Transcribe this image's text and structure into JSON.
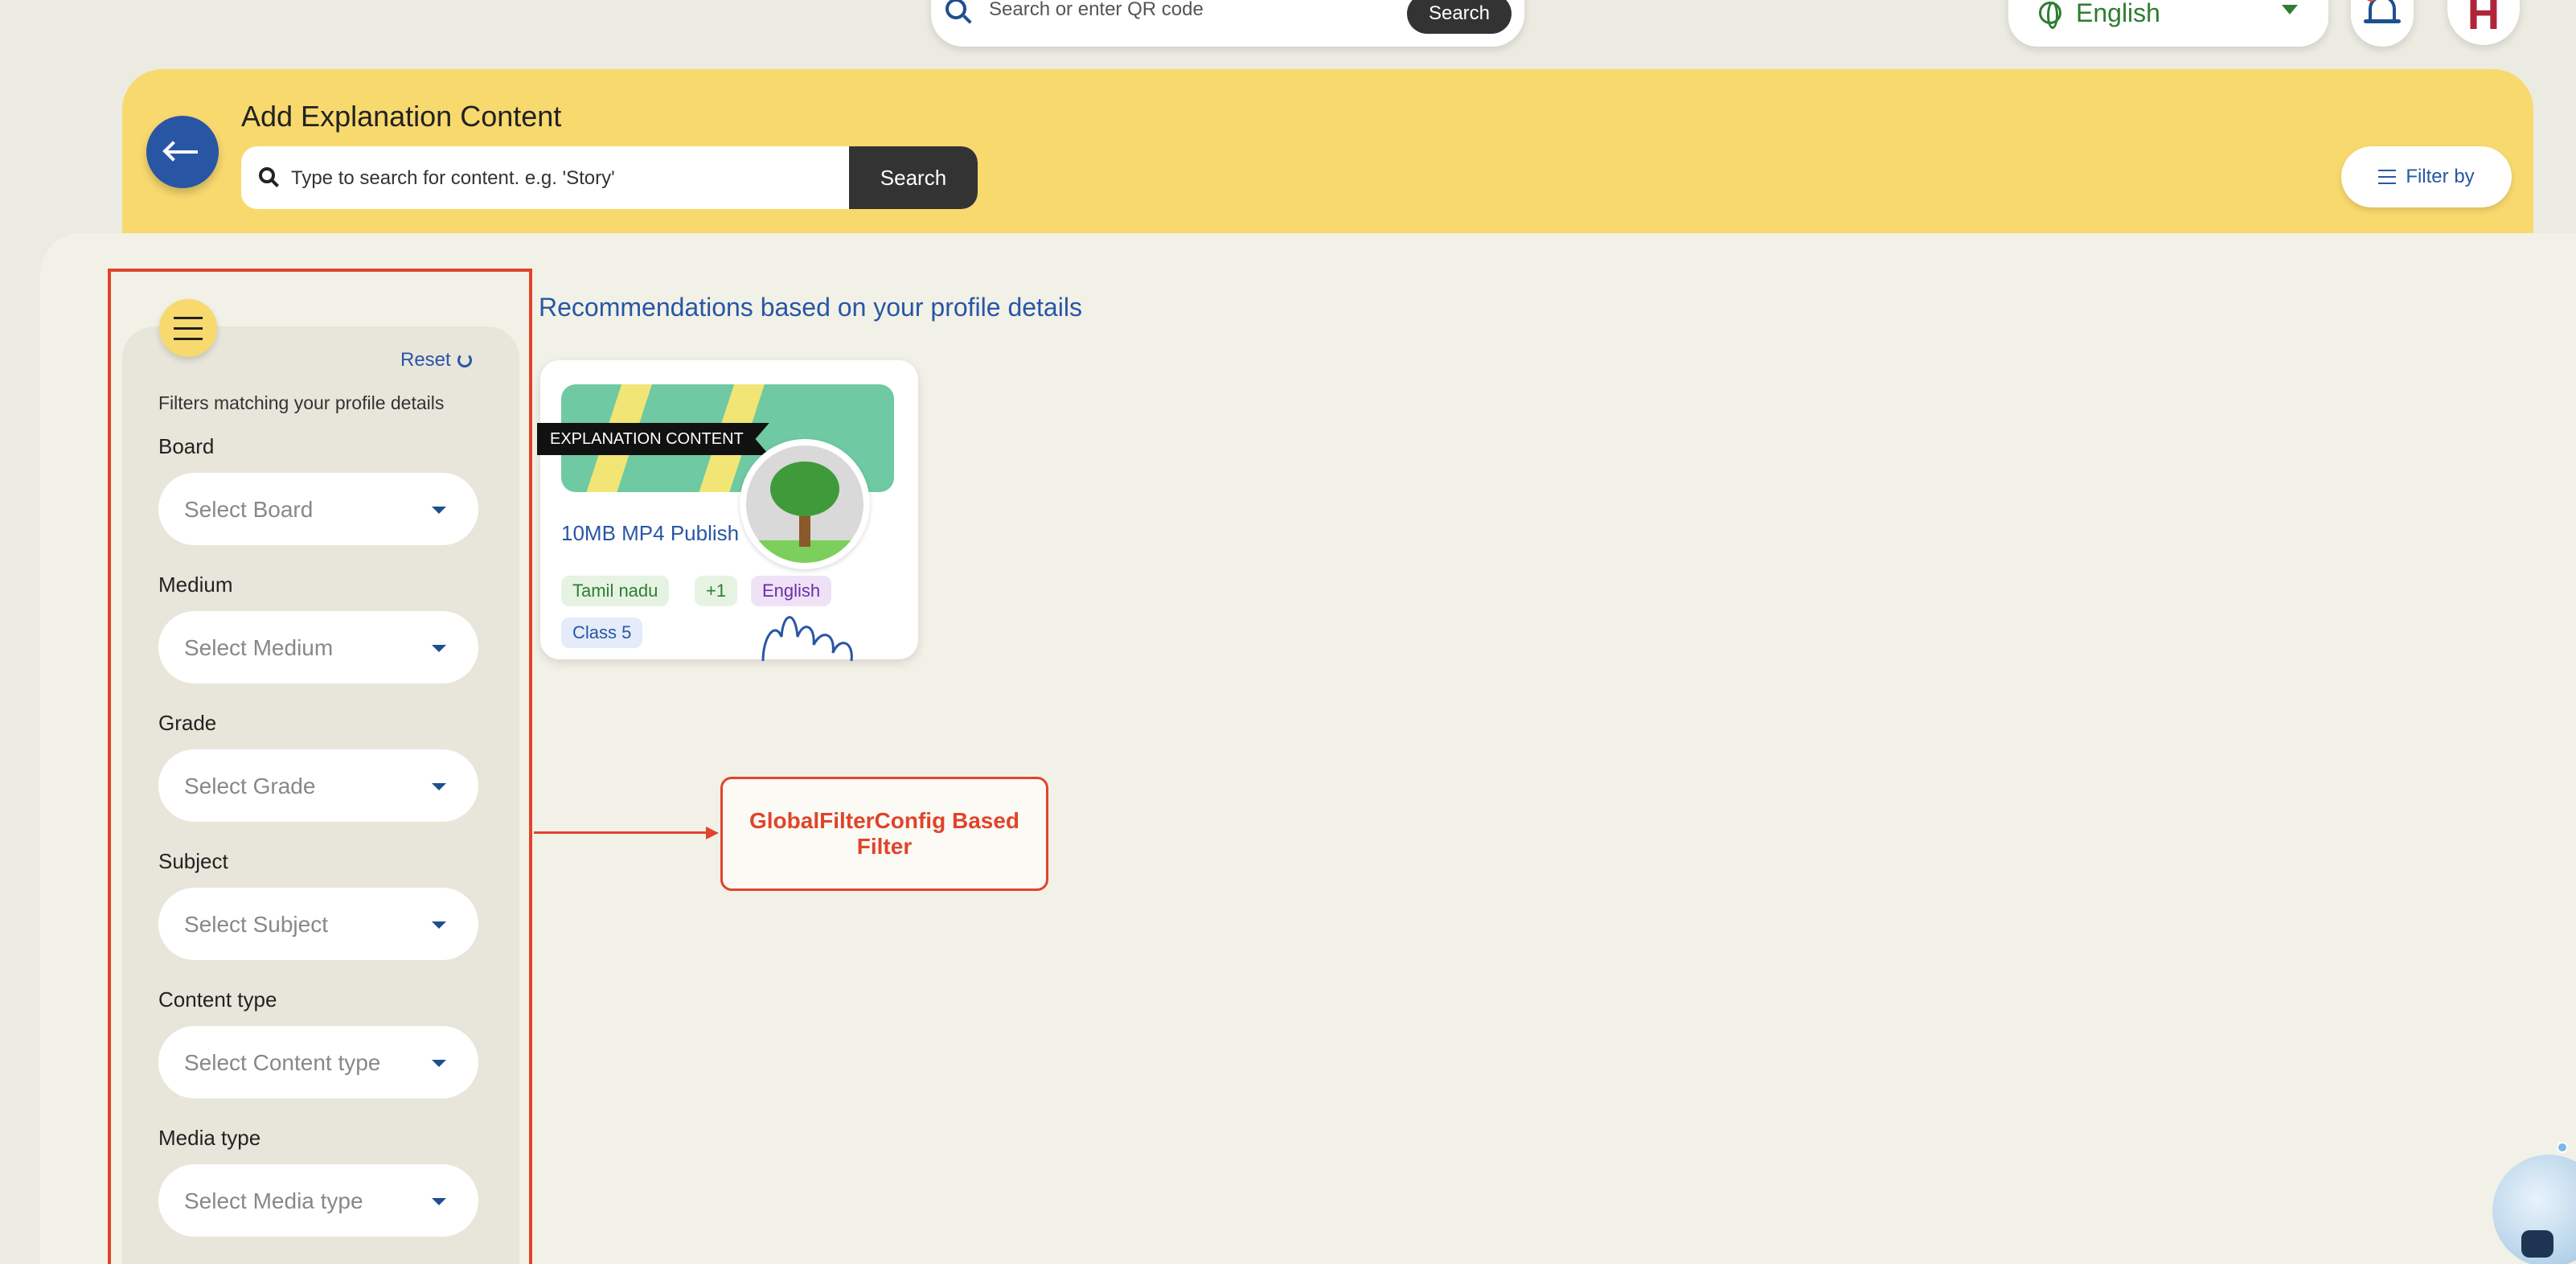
{
  "top_bar": {
    "search_placeholder": "Search or enter QR code",
    "search_button": "Search",
    "language": "English",
    "avatar_initial": "H"
  },
  "header": {
    "title": "Add Explanation Content",
    "search_placeholder": "Type to search for content. e.g. 'Story'",
    "search_button": "Search",
    "filter_button": "Filter by"
  },
  "filters": {
    "reset_label": "Reset",
    "note": "Filters matching your profile details",
    "fields": [
      {
        "label": "Board",
        "placeholder": "Select Board"
      },
      {
        "label": "Medium",
        "placeholder": "Select Medium"
      },
      {
        "label": "Grade",
        "placeholder": "Select Grade"
      },
      {
        "label": "Subject",
        "placeholder": "Select Subject"
      },
      {
        "label": "Content type",
        "placeholder": "Select Content type"
      },
      {
        "label": "Media type",
        "placeholder": "Select Media type"
      }
    ]
  },
  "recommendations": {
    "title": "Recommendations based on your profile details",
    "card": {
      "badge": "EXPLANATION CONTENT",
      "title": "10MB MP4 Publish",
      "chips": {
        "board": "Tamil nadu",
        "more": "+1",
        "language": "English",
        "class": "Class 5"
      }
    }
  },
  "annotation": {
    "label": "GlobalFilterConfig Based Filter"
  },
  "colors": {
    "header_yellow": "#f8d96e",
    "accent_blue": "#2856a5",
    "annotation_red": "#e0442b"
  }
}
